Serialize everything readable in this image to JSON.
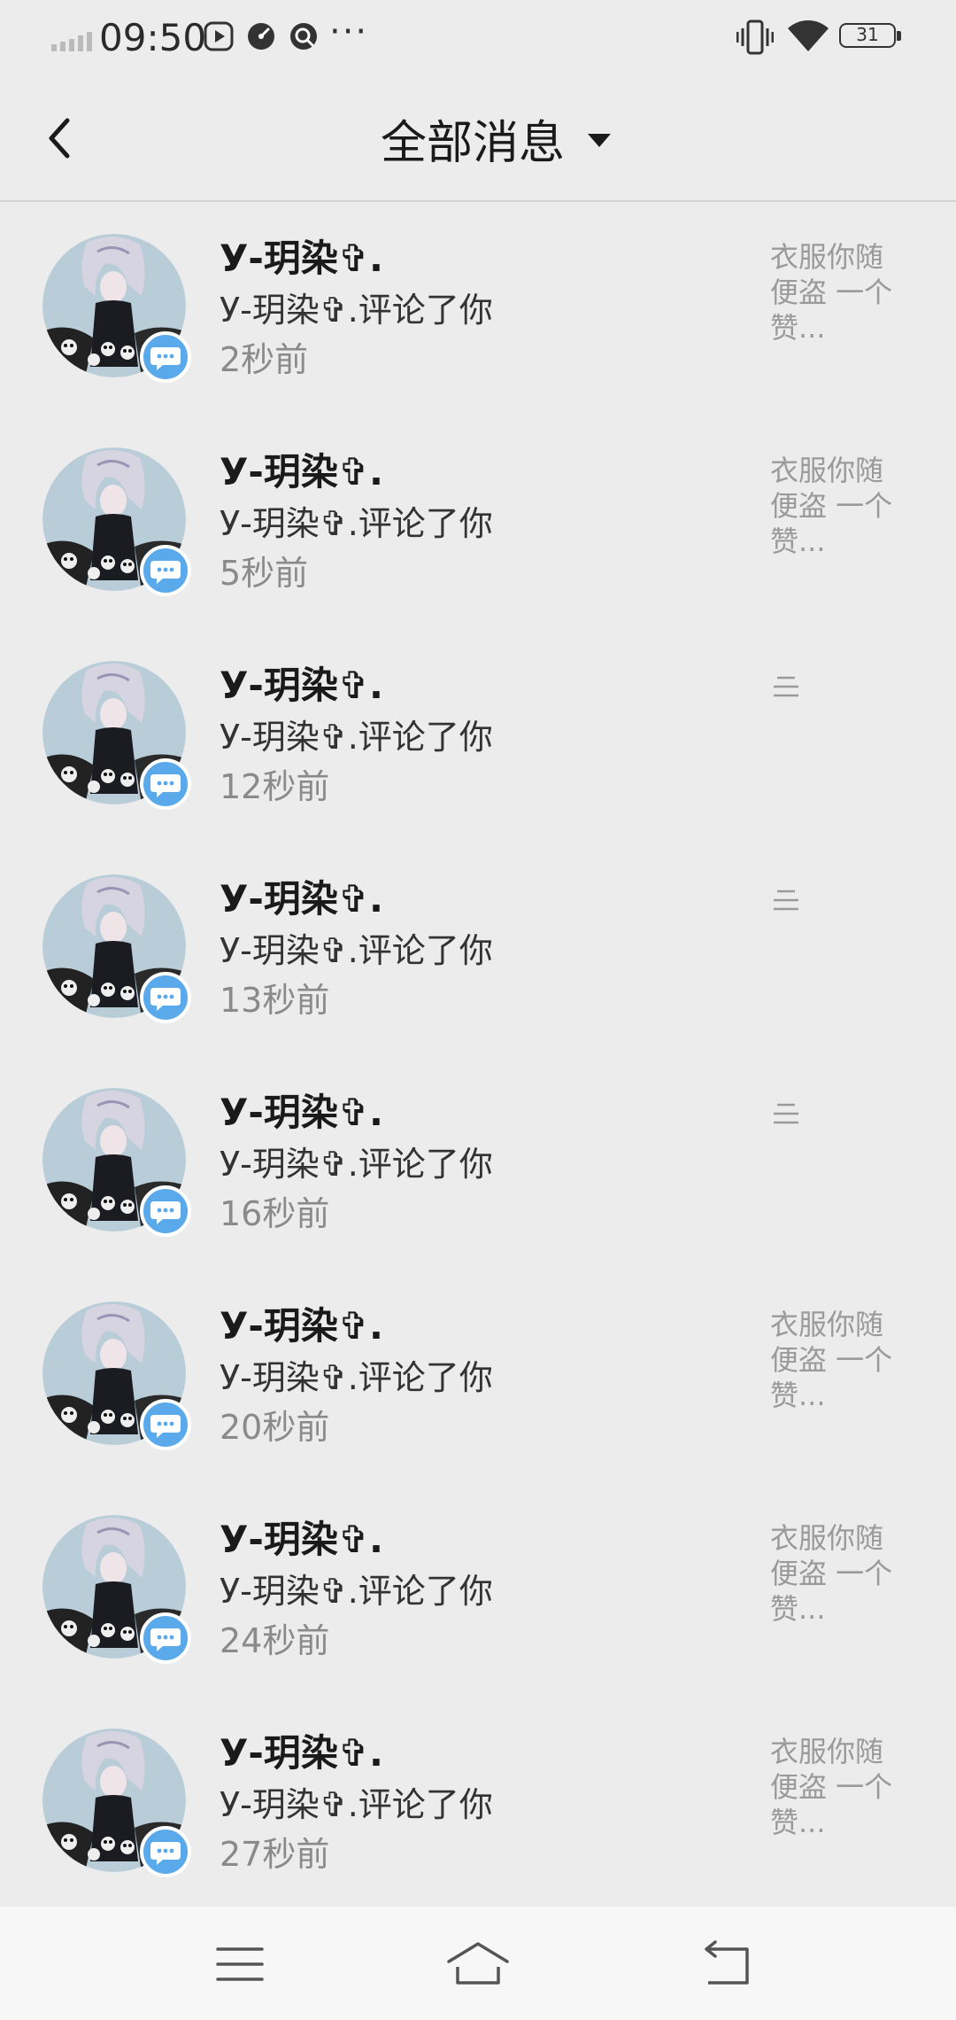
{
  "status_bar": {
    "time": "09:50",
    "battery": "31",
    "more": "···"
  },
  "header": {
    "title": "全部消息"
  },
  "colors": {
    "badge": "#5aa9ea",
    "background": "#ececec"
  },
  "messages": [
    {
      "name": "У-玥染✞.",
      "action": "У-玥染✞.评论了你",
      "time": "2秒前",
      "preview_type": "text",
      "preview": "衣服你随便盗 一个赞..."
    },
    {
      "name": "У-玥染✞.",
      "action": "У-玥染✞.评论了你",
      "time": "5秒前",
      "preview_type": "text",
      "preview": "衣服你随便盗 一个赞..."
    },
    {
      "name": "У-玥染✞.",
      "action": "У-玥染✞.评论了你",
      "time": "12秒前",
      "preview_type": "icon",
      "preview_icon": "text-lines-icon"
    },
    {
      "name": "У-玥染✞.",
      "action": "У-玥染✞.评论了你",
      "time": "13秒前",
      "preview_type": "icon",
      "preview_icon": "text-lines-icon"
    },
    {
      "name": "У-玥染✞.",
      "action": "У-玥染✞.评论了你",
      "time": "16秒前",
      "preview_type": "icon",
      "preview_icon": "text-lines-icon"
    },
    {
      "name": "У-玥染✞.",
      "action": "У-玥染✞.评论了你",
      "time": "20秒前",
      "preview_type": "text",
      "preview": "衣服你随便盗 一个赞..."
    },
    {
      "name": "У-玥染✞.",
      "action": "У-玥染✞.评论了你",
      "time": "24秒前",
      "preview_type": "text",
      "preview": "衣服你随便盗 一个赞..."
    },
    {
      "name": "У-玥染✞.",
      "action": "У-玥染✞.评论了你",
      "time": "27秒前",
      "preview_type": "text",
      "preview": "衣服你随便盗 一个赞..."
    }
  ],
  "nav": {
    "buttons": [
      "menu-icon",
      "home-icon",
      "back-nav-icon"
    ]
  }
}
